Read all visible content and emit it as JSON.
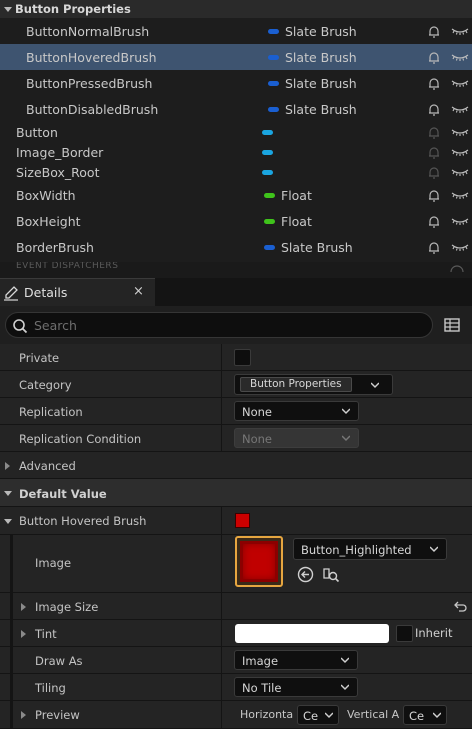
{
  "variables": {
    "category": "Button Properties",
    "items": [
      {
        "name": "ButtonNormalBrush",
        "type": "Slate Brush",
        "pin_color": "#1a5fd1",
        "hovered": false
      },
      {
        "name": "ButtonHoveredBrush",
        "type": "Slate Brush",
        "pin_color": "#1a5fd1",
        "hovered": true
      },
      {
        "name": "ButtonPressedBrush",
        "type": "Slate Brush",
        "pin_color": "#1a5fd1",
        "hovered": false
      },
      {
        "name": "ButtonDisabledBrush",
        "type": "Slate Brush",
        "pin_color": "#1a5fd1",
        "hovered": false
      },
      {
        "name": "Button",
        "type": "",
        "pin_color": "#1aa5e0",
        "hovered": false
      },
      {
        "name": "Image_Border",
        "type": "",
        "pin_color": "#1aa5e0",
        "hovered": false
      },
      {
        "name": "SizeBox_Root",
        "type": "",
        "pin_color": "#1aa5e0",
        "hovered": false
      },
      {
        "name": "BoxWidth",
        "type": "Float",
        "pin_color": "#3fc31b",
        "hovered": false
      },
      {
        "name": "BoxHeight",
        "type": "Float",
        "pin_color": "#3fc31b",
        "hovered": false
      },
      {
        "name": "BorderBrush",
        "type": "Slate Brush",
        "pin_color": "#1a5fd1",
        "hovered": false
      }
    ],
    "event_dispatchers": "EVENT DISPATCHERS"
  },
  "details_tab": {
    "label": "Details",
    "close": "×"
  },
  "search": {
    "placeholder": "Search"
  },
  "details": {
    "private_label": "Private",
    "category_label": "Category",
    "category_value": "Button Properties",
    "replication_label": "Replication",
    "replication_value": "None",
    "replication_condition_label": "Replication Condition",
    "replication_condition_value": "None",
    "advanced_label": "Advanced",
    "default_value_label": "Default Value",
    "button_hovered_brush_label": "Button Hovered Brush",
    "brush_color": "#cc0000",
    "image_label": "Image",
    "image_value": "Button_Highlighted",
    "image_size_label": "Image Size",
    "tint_label": "Tint",
    "tint_color": "#ffffff",
    "inherit_label": "Inherit",
    "draw_as_label": "Draw As",
    "draw_as_value": "Image",
    "tiling_label": "Tiling",
    "tiling_value": "No Tile",
    "preview_label": "Preview",
    "horizontal_label": "Horizonta",
    "horizontal_value": "Ce",
    "vertical_label": "Vertical A",
    "vertical_value": "Ce"
  }
}
